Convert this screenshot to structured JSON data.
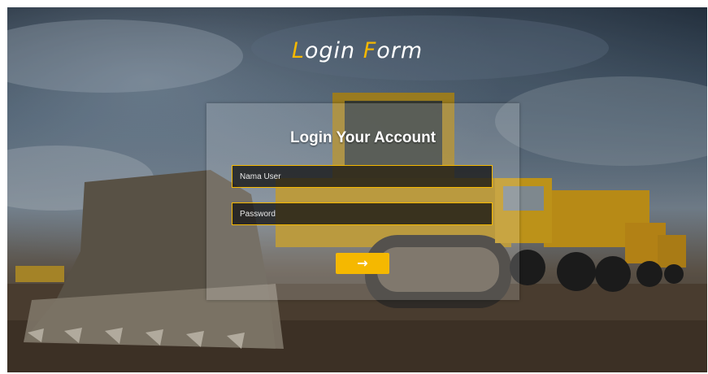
{
  "header": {
    "title_first_initial": "L",
    "title_first_rest": "ogin",
    "title_second_initial": "F",
    "title_second_rest": "orm"
  },
  "login_panel": {
    "heading": "Login Your Account",
    "username_placeholder": "Nama User",
    "password_placeholder": "Password",
    "submit_icon": "→"
  },
  "colors": {
    "accent": "#f5b800",
    "panel_bg": "rgba(255,255,255,0.18)",
    "field_bg": "#141414",
    "text": "#ffffff"
  },
  "icons": {
    "submit": "arrow-right-icon"
  }
}
